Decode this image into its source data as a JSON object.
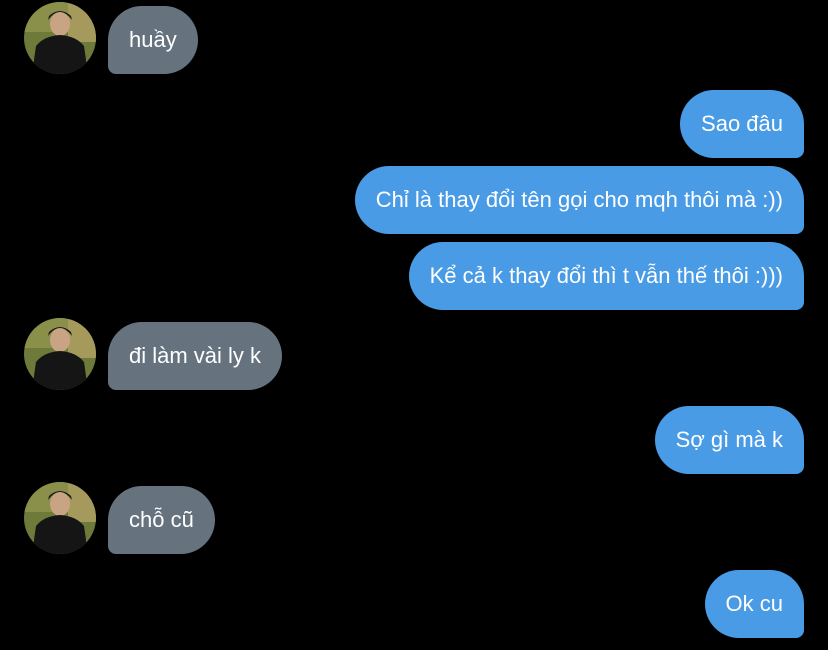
{
  "colors": {
    "background": "#000000",
    "incoming_bubble": "#66737f",
    "outgoing_bubble": "#4a9be6",
    "text": "#ffffff"
  },
  "messages": [
    {
      "direction": "incoming",
      "text": "huầy"
    },
    {
      "direction": "outgoing",
      "text": "Sao đâu"
    },
    {
      "direction": "outgoing",
      "text": "Chỉ là thay đổi tên gọi cho mqh thôi mà :))"
    },
    {
      "direction": "outgoing",
      "text": "Kể cả k thay đổi thì t vẫn thế thôi :)))"
    },
    {
      "direction": "incoming",
      "text": "đi làm vài ly k"
    },
    {
      "direction": "outgoing",
      "text": "Sợ gì mà k"
    },
    {
      "direction": "incoming",
      "text": "chỗ cũ"
    },
    {
      "direction": "outgoing",
      "text": "Ok cu"
    }
  ]
}
